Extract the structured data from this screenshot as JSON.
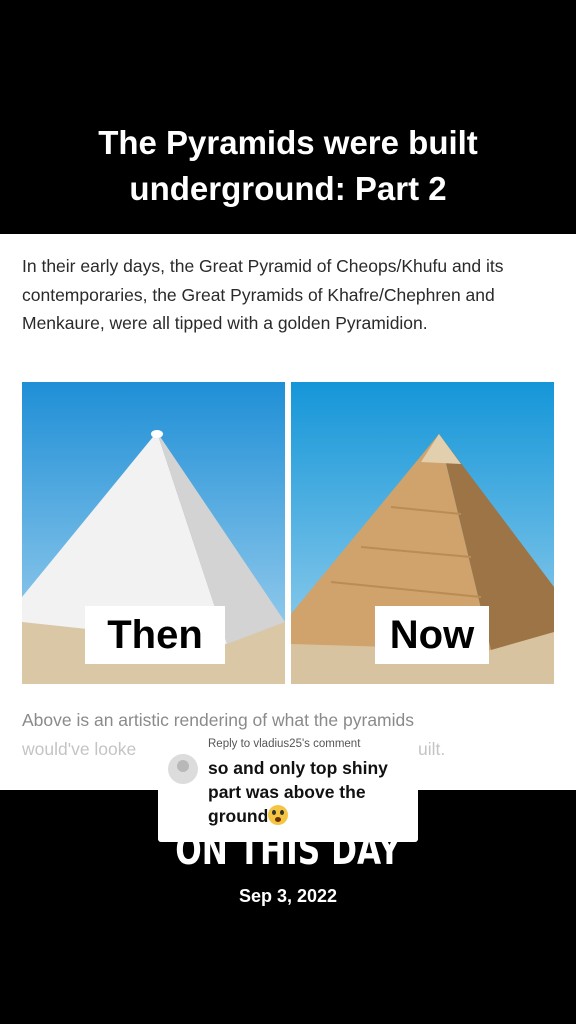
{
  "video": {
    "title_line1": "The Pyramids were built",
    "title_line2": "underground: Part 2"
  },
  "article": {
    "paragraph": "In their early days, the Great Pyramid of Cheops/Khufu and its contemporaries, the Great Pyramids of Khafre/Chephren and Menkaure, were all tipped with a golden Pyramidion.",
    "images": [
      {
        "label": "Then"
      },
      {
        "label": "Now"
      }
    ],
    "caption_line1": "Above is an artistic rendering of what the pyramids",
    "caption_line2_start": "would've looke",
    "caption_line2_end": "uilt."
  },
  "overlay": {
    "title": "ON THIS DAY",
    "date": "Sep 3, 2022"
  },
  "reply": {
    "header": "Reply to vladius25's comment",
    "line1": "so and only top shiny",
    "line2": "part was above the",
    "line3": "ground",
    "emoji": "flushed-face"
  }
}
